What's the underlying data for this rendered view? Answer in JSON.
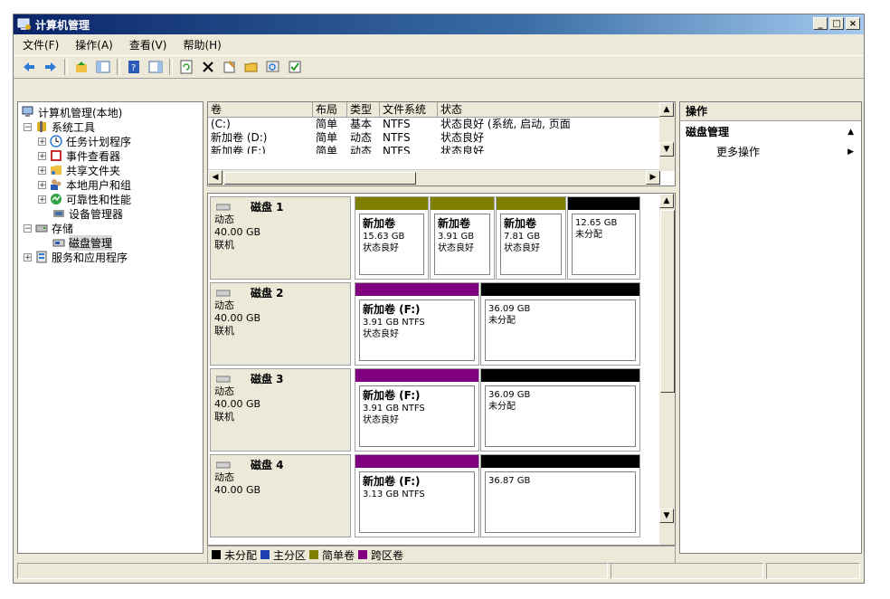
{
  "window": {
    "title": "计算机管理"
  },
  "menu": [
    "文件(F)",
    "操作(A)",
    "查看(V)",
    "帮助(H)"
  ],
  "tree": {
    "root": "计算机管理(本地)",
    "system_tools": "系统工具",
    "task_scheduler": "任务计划程序",
    "event_viewer": "事件查看器",
    "shared_folders": "共享文件夹",
    "local_users": "本地用户和组",
    "reliability": "可靠性和性能",
    "device_manager": "设备管理器",
    "storage": "存储",
    "disk_management": "磁盘管理",
    "services": "服务和应用程序"
  },
  "volume_list": {
    "columns": [
      "卷",
      "布局",
      "类型",
      "文件系统",
      "状态"
    ],
    "rows": [
      [
        "(C:)",
        "简单",
        "基本",
        "NTFS",
        "状态良好 (系统, 启动, 页面"
      ],
      [
        "新加卷 (D:)",
        "简单",
        "动态",
        "NTFS",
        "状态良好"
      ],
      [
        "新加卷 (E:)",
        "简单",
        "动态",
        "NTFS",
        "状态良好"
      ]
    ]
  },
  "disks": [
    {
      "name": "磁盘 1",
      "type": "动态",
      "size": "40.00 GB",
      "status": "联机",
      "partitions": [
        {
          "title": "新加卷",
          "size": "15.63 GB",
          "state": "状态良好",
          "kind": "simple"
        },
        {
          "title": "新加卷",
          "size": "3.91 GB",
          "state": "状态良好",
          "kind": "simple"
        },
        {
          "title": "新加卷",
          "size": "7.81 GB",
          "state": "状态良好",
          "kind": "simple"
        },
        {
          "title": "",
          "size": "12.65 GB",
          "state": "未分配",
          "kind": "unallocated"
        }
      ]
    },
    {
      "name": "磁盘 2",
      "type": "动态",
      "size": "40.00 GB",
      "status": "联机",
      "partitions": [
        {
          "title": "新加卷 (F:)",
          "size": "3.91 GB NTFS",
          "state": "状态良好",
          "kind": "spanned"
        },
        {
          "title": "",
          "size": "36.09 GB",
          "state": "未分配",
          "kind": "unallocated"
        }
      ]
    },
    {
      "name": "磁盘 3",
      "type": "动态",
      "size": "40.00 GB",
      "status": "联机",
      "partitions": [
        {
          "title": "新加卷 (F:)",
          "size": "3.91 GB NTFS",
          "state": "状态良好",
          "kind": "spanned"
        },
        {
          "title": "",
          "size": "36.09 GB",
          "state": "未分配",
          "kind": "unallocated"
        }
      ]
    },
    {
      "name": "磁盘 4",
      "type": "动态",
      "size": "40.00 GB",
      "status": "",
      "partitions": [
        {
          "title": "新加卷 (F:)",
          "size": "3.13 GB NTFS",
          "state": "",
          "kind": "spanned"
        },
        {
          "title": "",
          "size": "36.87 GB",
          "state": "",
          "kind": "unallocated"
        }
      ]
    }
  ],
  "legend": [
    {
      "label": "未分配",
      "color": "#000000"
    },
    {
      "label": "主分区",
      "color": "#1c3fb0"
    },
    {
      "label": "简单卷",
      "color": "#808000"
    },
    {
      "label": "跨区卷",
      "color": "#800080"
    }
  ],
  "actions": {
    "header": "操作",
    "section": "磁盘管理",
    "more": "更多操作"
  },
  "colors": {
    "simple": "#808000",
    "spanned": "#800080",
    "unallocated": "#000000"
  }
}
